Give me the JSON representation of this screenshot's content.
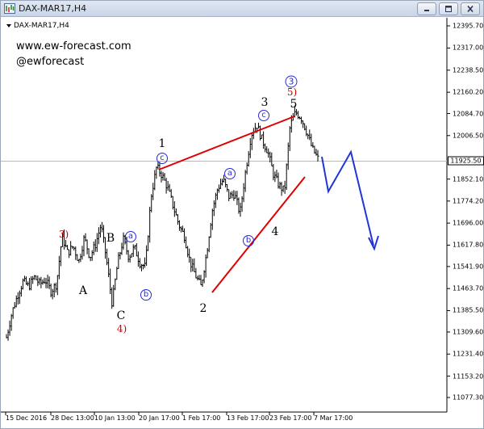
{
  "window": {
    "title": "DAX-MAR17,H4",
    "symbol_label": "DAX-MAR17,H4"
  },
  "watermark": {
    "url": "www.ew-forecast.com",
    "handle": "@ewforecast"
  },
  "axis": {
    "price_ticks": [
      "12395.70",
      "12317.00",
      "12238.50",
      "12160.20",
      "12084.70",
      "12006.50",
      "11852.10",
      "11774.20",
      "11696.00",
      "11617.80",
      "11541.90",
      "11463.70",
      "11385.50",
      "11309.60",
      "11231.40",
      "11153.20",
      "11077.30"
    ],
    "current_price": "11925.50",
    "time_ticks": [
      "15 Dec 2016",
      "28 Dec 13:00",
      "10 Jan 13:00",
      "20 Jan 17:00",
      "1 Feb 17:00",
      "13 Feb 17:00",
      "23 Feb 17:00",
      "7 Mar 17:00"
    ]
  },
  "wave_labels": {
    "red3": "3)",
    "B": "B",
    "A": "A",
    "C": "C",
    "red4": "4)",
    "one": "1",
    "two": "2",
    "three": "3",
    "four": "4",
    "five": "5",
    "red5": "5)",
    "circ_a1": "a",
    "circ_b1": "b",
    "circ_c1": "c",
    "circ_a2": "a",
    "circ_b2": "b",
    "circ_c2": "c",
    "circ_3": "3"
  },
  "colors": {
    "candles": "#000000",
    "wedge_lines": "#e00000",
    "projection": "#1f35d6",
    "wave_label_red": "#d40000",
    "circled_labels": "#2a2ad8"
  },
  "chart_data": {
    "type": "line",
    "title": "DAX-MAR17,H4",
    "timeframe": "H4",
    "x_labels": [
      "15 Dec 2016",
      "28 Dec 13:00",
      "10 Jan 13:00",
      "20 Jan 17:00",
      "1 Feb 17:00",
      "13 Feb 17:00",
      "23 Feb 17:00",
      "7 Mar 17:00"
    ],
    "y_range": [
      11077.3,
      12395.7
    ],
    "current_price": 11925.5,
    "price_path": [
      11290,
      11380,
      11440,
      11490,
      11470,
      11505,
      11480,
      11495,
      11455,
      11480,
      11650,
      11590,
      11615,
      11560,
      11645,
      11575,
      11620,
      11690,
      11565,
      11410,
      11555,
      11640,
      11575,
      11610,
      11555,
      11540,
      11790,
      11895,
      11865,
      11820,
      11755,
      11690,
      11650,
      11560,
      11510,
      11470,
      11590,
      11740,
      11820,
      11850,
      11790,
      11800,
      11730,
      11880,
      12010,
      12045,
      11990,
      11950,
      11870,
      11830,
      11810,
      12040,
      12090,
      12070,
      12020,
      11960,
      11925
    ],
    "projection_path": [
      11935,
      11840,
      11960,
      11665
    ],
    "wedge_upper": [
      11885,
      12080
    ],
    "wedge_lower": [
      11475,
      11880
    ]
  }
}
